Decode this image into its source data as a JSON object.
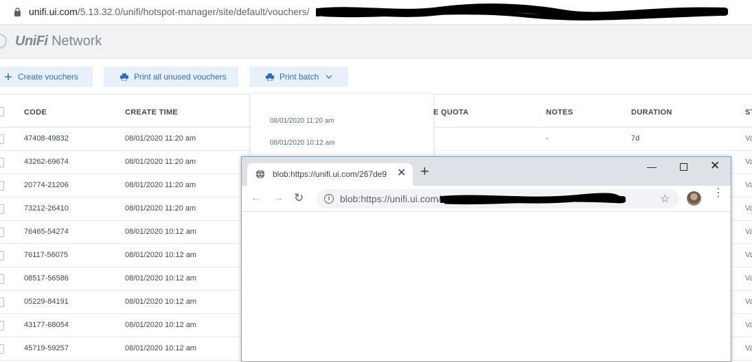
{
  "address_bar": {
    "host": "unifi.ui.com",
    "path": "/5.13.32.0/unifi/hotspot-manager/site/default/vouchers/"
  },
  "header": {
    "brand": "UniFi",
    "product": "Network"
  },
  "toolbar": {
    "create_label": "Create vouchers",
    "print_all_label": "Print all unused vouchers",
    "print_batch_label": "Print batch"
  },
  "table": {
    "columns": [
      "CODE",
      "CREATE TIME",
      "E QUOTA",
      "NOTES",
      "DURATION",
      "ST"
    ],
    "rows": [
      {
        "code": "47408-49832",
        "time": "08/01/2020 11:20 am",
        "notes": "-",
        "duration": "7d",
        "status": "Va"
      },
      {
        "code": "43262-69674",
        "time": "08/01/2020 11:20 am",
        "status": "Va"
      },
      {
        "code": "20774-21206",
        "time": "08/01/2020 11:20 am",
        "status": "Va"
      },
      {
        "code": "73212-26410",
        "time": "08/01/2020 11:20 am",
        "status": "Va"
      },
      {
        "code": "76465-54274",
        "time": "08/01/2020 10:12 am",
        "status": "Va"
      },
      {
        "code": "76117-56075",
        "time": "08/01/2020 10:12 am",
        "status": "Va"
      },
      {
        "code": "08517-56586",
        "time": "08/01/2020 10:12 am",
        "status": "Va"
      },
      {
        "code": "05229-84191",
        "time": "08/01/2020 10:12 am",
        "status": "Va"
      },
      {
        "code": "43177-68054",
        "time": "08/01/2020 10:12 am",
        "status": "Va"
      },
      {
        "code": "45719-59257",
        "time": "08/01/2020 10:12 am",
        "status": "Va"
      }
    ]
  },
  "dropdown": {
    "items": [
      "08/01/2020 11:20 am",
      "08/01/2020 10:12 am"
    ]
  },
  "popup": {
    "tab_title": "blob:https://unifi.ui.com/267de9",
    "url": "blob:https://unifi.ui.com/"
  }
}
